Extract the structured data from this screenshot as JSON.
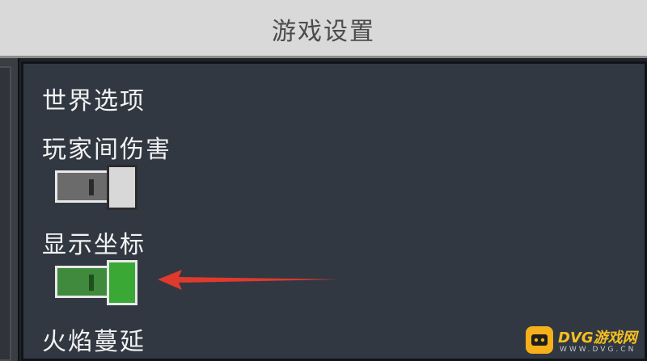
{
  "window": {
    "title": "游戏设置"
  },
  "sections": {
    "world_options": "世界选项",
    "pvp": {
      "label": "玩家间伤害",
      "state": "off"
    },
    "coords": {
      "label": "显示坐标",
      "state": "on"
    },
    "fire_spread": {
      "label": "火焰蔓延"
    }
  },
  "watermark": {
    "brand": "DVG游戏网",
    "domain": "WWW.DVG.CN"
  },
  "colors": {
    "toggle_on": "#3aa835",
    "toggle_off": "#d8d8d8",
    "arrow": "#e03a2e",
    "watermark": "#f5b01a"
  }
}
